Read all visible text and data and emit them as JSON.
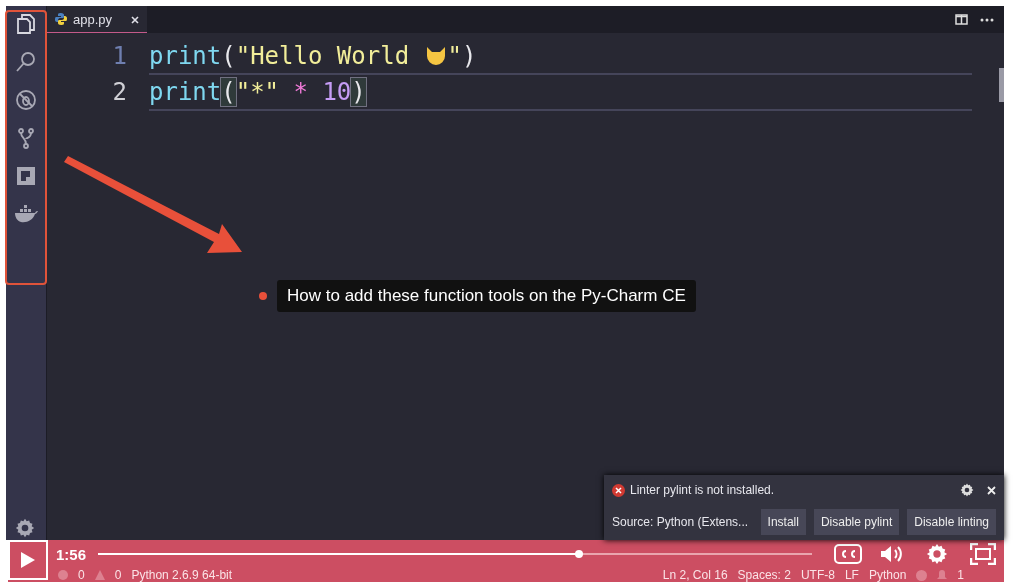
{
  "activity_bar": {
    "items": [
      {
        "kind": "files",
        "selected": true
      },
      {
        "kind": "search",
        "selected": false
      },
      {
        "kind": "debug",
        "selected": false
      },
      {
        "kind": "source-control",
        "selected": false
      },
      {
        "kind": "extensions",
        "selected": false
      },
      {
        "kind": "docker",
        "selected": false
      }
    ],
    "highlighted": true
  },
  "editor": {
    "tabs": [
      {
        "label": "app.py",
        "selected": true
      }
    ],
    "lines": [
      {
        "number": "1",
        "active": false,
        "tokens": [
          {
            "kind": "func",
            "text": "print"
          },
          {
            "kind": "paren",
            "text": "("
          },
          {
            "kind": "string",
            "text": "\"Hello World "
          },
          {
            "kind": "emoji"
          },
          {
            "kind": "string",
            "text": "\""
          },
          {
            "kind": "paren",
            "text": ")"
          }
        ]
      },
      {
        "number": "2",
        "active": true,
        "tokens": [
          {
            "kind": "func",
            "text": "print"
          },
          {
            "kind": "paren",
            "text": "(",
            "matched": true
          },
          {
            "kind": "string",
            "text": "\"*\""
          },
          {
            "kind": "op",
            "text": " * "
          },
          {
            "kind": "number",
            "text": "10"
          },
          {
            "kind": "paren",
            "text": ")",
            "matched": true
          }
        ]
      }
    ]
  },
  "annotation": {
    "text": "How to add these function tools on the Py-Charm CE"
  },
  "notification": {
    "message": "Linter pylint is not installed.",
    "source": "Source: Python (Extens...",
    "buttons": [
      "Install",
      "Disable pylint",
      "Disable linting"
    ]
  },
  "player": {
    "time": "1:56",
    "level": 0.673
  },
  "status_bar": {
    "errors": "0",
    "warnings": "0",
    "interpreter": "Python 2.6.9 64-bit",
    "right": [
      "Ln 2, Col 16",
      "Spaces: 2",
      "UTF-8",
      "LF",
      "Python"
    ],
    "notifications": "1"
  }
}
